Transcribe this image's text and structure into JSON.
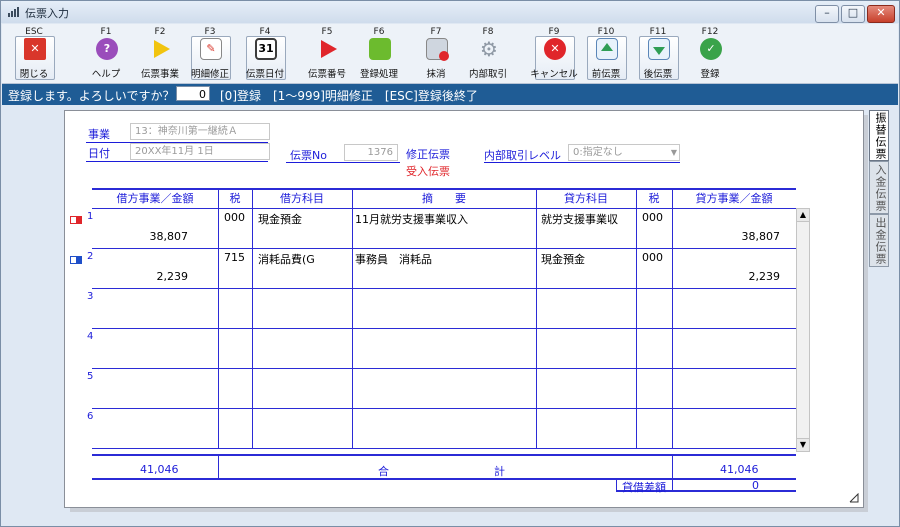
{
  "window": {
    "title": "伝票入力",
    "min": "–",
    "max": "□",
    "close": "✕"
  },
  "toolbar": [
    {
      "key": "ESC",
      "label": "閉じる",
      "icon": "close-window-icon",
      "color": "#d9362b"
    },
    {
      "key": "F1",
      "label": "ヘルプ",
      "icon": "help-icon",
      "color": "#9a4dbb"
    },
    {
      "key": "F2",
      "label": "伝票事業",
      "icon": "play-arrow-icon",
      "color": "#f1c40f"
    },
    {
      "key": "F3",
      "label": "明細修正",
      "icon": "edit-icon",
      "color": "#e06d2a"
    },
    {
      "key": "F4",
      "label": "伝票日付",
      "icon": "calendar-icon",
      "color": "#3c3c3c",
      "text": "31"
    },
    {
      "key": "F5",
      "label": "伝票番号",
      "icon": "play-red-icon",
      "color": "#e0262b"
    },
    {
      "key": "F6",
      "label": "登録処理",
      "icon": "register-book-icon",
      "color": "#6cbb2e"
    },
    {
      "key": "F7",
      "label": "抹消",
      "icon": "delete-doc-icon",
      "color": "#cfd6df"
    },
    {
      "key": "F8",
      "label": "内部取引",
      "icon": "gear-icon",
      "color": "#b0b8c2"
    },
    {
      "key": "F9",
      "label": "キャンセル",
      "icon": "cancel-icon",
      "color": "#e0262b"
    },
    {
      "key": "F10",
      "label": "前伝票",
      "icon": "prev-voucher-icon",
      "color": "#2f9e55"
    },
    {
      "key": "F11",
      "label": "後伝票",
      "icon": "next-voucher-icon",
      "color": "#2f9e55"
    },
    {
      "key": "F12",
      "label": "登録",
      "icon": "check-icon",
      "color": "#3aa34a"
    }
  ],
  "status": {
    "message": "登録します。よろしいですか？",
    "value": "0",
    "hint": "[0]登録　[1～999]明細修正　[ESC]登録後終了"
  },
  "header": {
    "jigyo_label": "事業",
    "jigyo_value": "13：神奈川第一継続Ａ",
    "date_label": "日付",
    "date_value": "20XX年11月 1日",
    "voucher_no_label": "伝票No",
    "voucher_no_value": "1376",
    "mode_label": "修正伝票",
    "voucher_type": "受入伝票",
    "internal_label": "内部取引レベル",
    "internal_value": "0:指定なし"
  },
  "columns": [
    "借方事業／金額",
    "税",
    "借方科目",
    "摘　　要",
    "貸方科目",
    "税",
    "貸方事業／金額"
  ],
  "rows": [
    {
      "no": "1",
      "debit_amount": "38,807",
      "tax1": "000",
      "debit_account": "現金預金",
      "summary": "11月就労支援事業収入",
      "credit_account": "就労支援事業収",
      "tax2": "000",
      "credit_amount": "38,807",
      "marker": "#e0262b"
    },
    {
      "no": "2",
      "debit_amount": "2,239",
      "tax1": "715",
      "debit_account": "消耗品費(G",
      "summary": "事務員　消耗品",
      "credit_account": "現金預金",
      "tax2": "000",
      "credit_amount": "2,239",
      "marker": "#1f4fc9"
    },
    {
      "no": "3"
    },
    {
      "no": "4"
    },
    {
      "no": "5"
    },
    {
      "no": "6"
    }
  ],
  "totals": {
    "debit": "41,046",
    "label_left": "合",
    "label_right": "計",
    "credit": "41,046",
    "diff_label": "貸借差額",
    "diff": "0"
  },
  "sidetabs": [
    "振替伝票",
    "入金伝票",
    "出金伝票"
  ]
}
